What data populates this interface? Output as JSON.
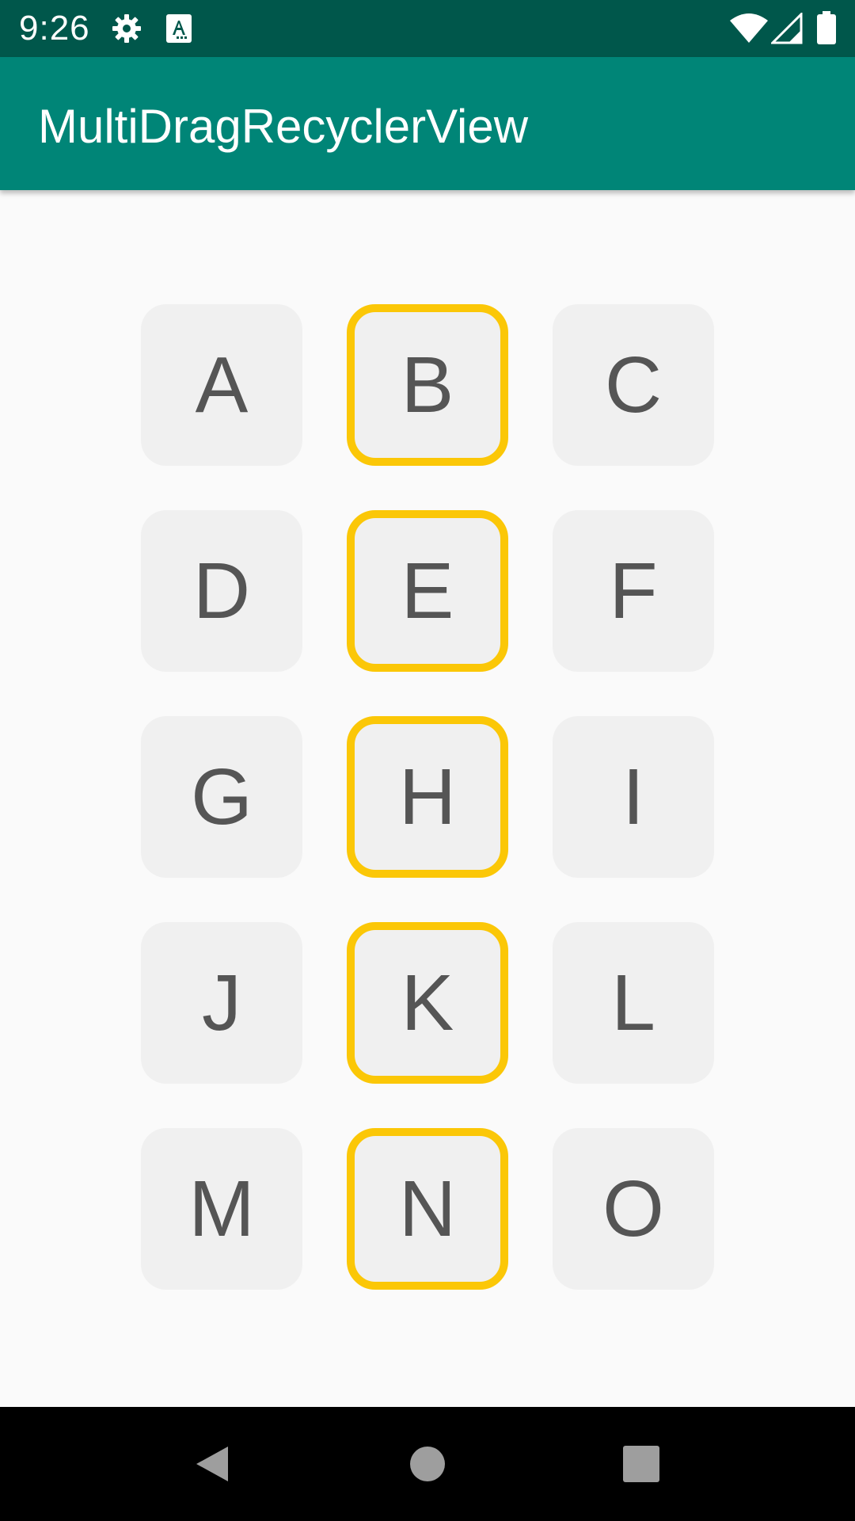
{
  "status_bar": {
    "time": "9:26",
    "icons": [
      "gear-icon",
      "text-accessibility-icon",
      "wifi-icon",
      "cellular-signal-icon",
      "battery-icon"
    ],
    "background": "#00574b"
  },
  "app_bar": {
    "title": "MultiDragRecyclerView",
    "background": "#008577"
  },
  "grid": {
    "selected_color": "#fbc707",
    "tile_color": "#f0f0f0",
    "items": [
      {
        "label": "A",
        "selected": false
      },
      {
        "label": "B",
        "selected": true
      },
      {
        "label": "C",
        "selected": false
      },
      {
        "label": "D",
        "selected": false
      },
      {
        "label": "E",
        "selected": true
      },
      {
        "label": "F",
        "selected": false
      },
      {
        "label": "G",
        "selected": false
      },
      {
        "label": "H",
        "selected": true
      },
      {
        "label": "I",
        "selected": false
      },
      {
        "label": "J",
        "selected": false
      },
      {
        "label": "K",
        "selected": true
      },
      {
        "label": "L",
        "selected": false
      },
      {
        "label": "M",
        "selected": false
      },
      {
        "label": "N",
        "selected": true
      },
      {
        "label": "O",
        "selected": false
      }
    ]
  },
  "nav_bar": {
    "buttons": [
      "back-icon",
      "home-icon",
      "recents-icon"
    ]
  }
}
